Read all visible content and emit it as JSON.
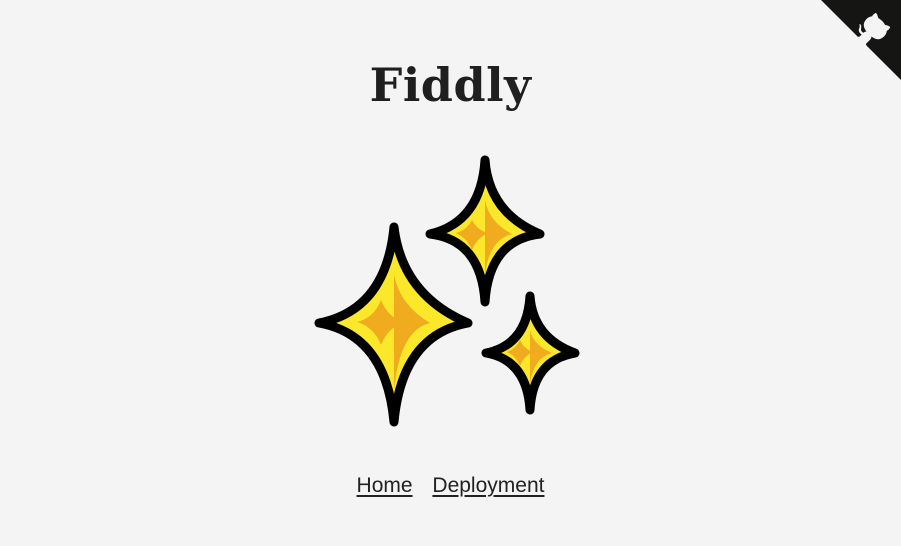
{
  "header": {
    "title": "Fiddly"
  },
  "corner_link": {
    "icon": "github-octocat-icon",
    "background_color": "#151513",
    "icon_color": "#f4f4f4"
  },
  "logo": {
    "icon": "sparkles-icon",
    "colors": {
      "fill_light": "#fce82a",
      "fill_dark": "#f0ab1e",
      "outline": "#000000"
    }
  },
  "nav": {
    "home_label": "Home",
    "deployment_label": "Deployment"
  },
  "page": {
    "background": "#f4f4f4"
  }
}
